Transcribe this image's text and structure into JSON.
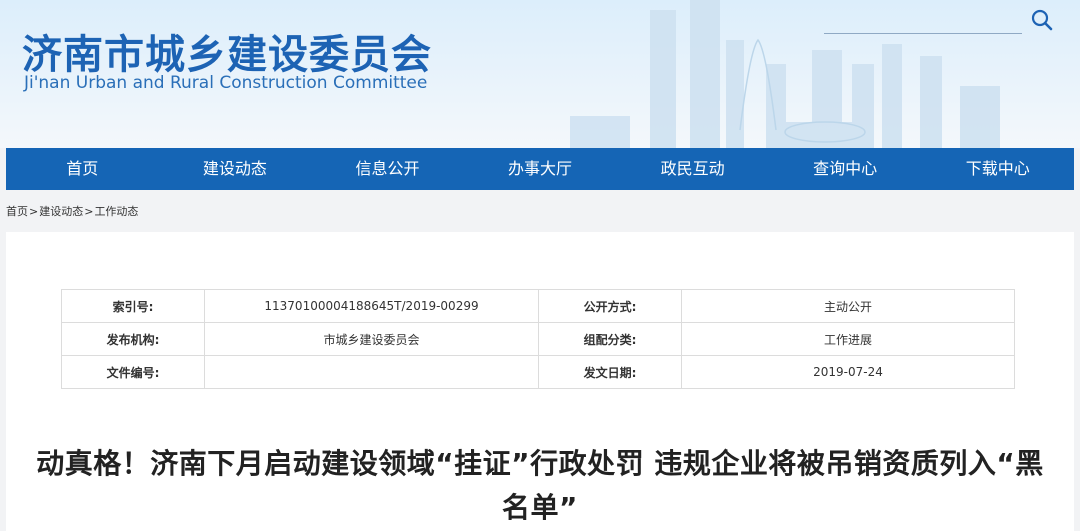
{
  "header": {
    "site_title": "济南市城乡建设委员会",
    "site_subtitle": "Ji'nan Urban and Rural Construction Committee",
    "search_placeholder": "",
    "brand_color": "#1d63b4"
  },
  "nav": {
    "items": [
      {
        "label": "首页"
      },
      {
        "label": "建设动态"
      },
      {
        "label": "信息公开"
      },
      {
        "label": "办事大厅"
      },
      {
        "label": "政民互动"
      },
      {
        "label": "查询中心"
      },
      {
        "label": "下载中心"
      }
    ],
    "color": "#1565b5"
  },
  "breadcrumb": {
    "home": "首页",
    "sep1": ">",
    "section": "建设动态",
    "sep2": ">",
    "current": "工作动态"
  },
  "info": {
    "row1": {
      "k1": "索引号:",
      "v1": "11370100004188645T/2019-00299",
      "k2": "公开方式:",
      "v2": "主动公开"
    },
    "row2": {
      "k1": "发布机构:",
      "v1": "市城乡建设委员会",
      "k2": "组配分类:",
      "v2": "工作进展"
    },
    "row3": {
      "k1": "文件编号:",
      "v1": "",
      "k2": "发文日期:",
      "v2": "2019-07-24"
    }
  },
  "article": {
    "title": "动真格！济南下月启动建设领域“挂证”行政处罚 违规企业将被吊销资质列入“黑名单”"
  }
}
